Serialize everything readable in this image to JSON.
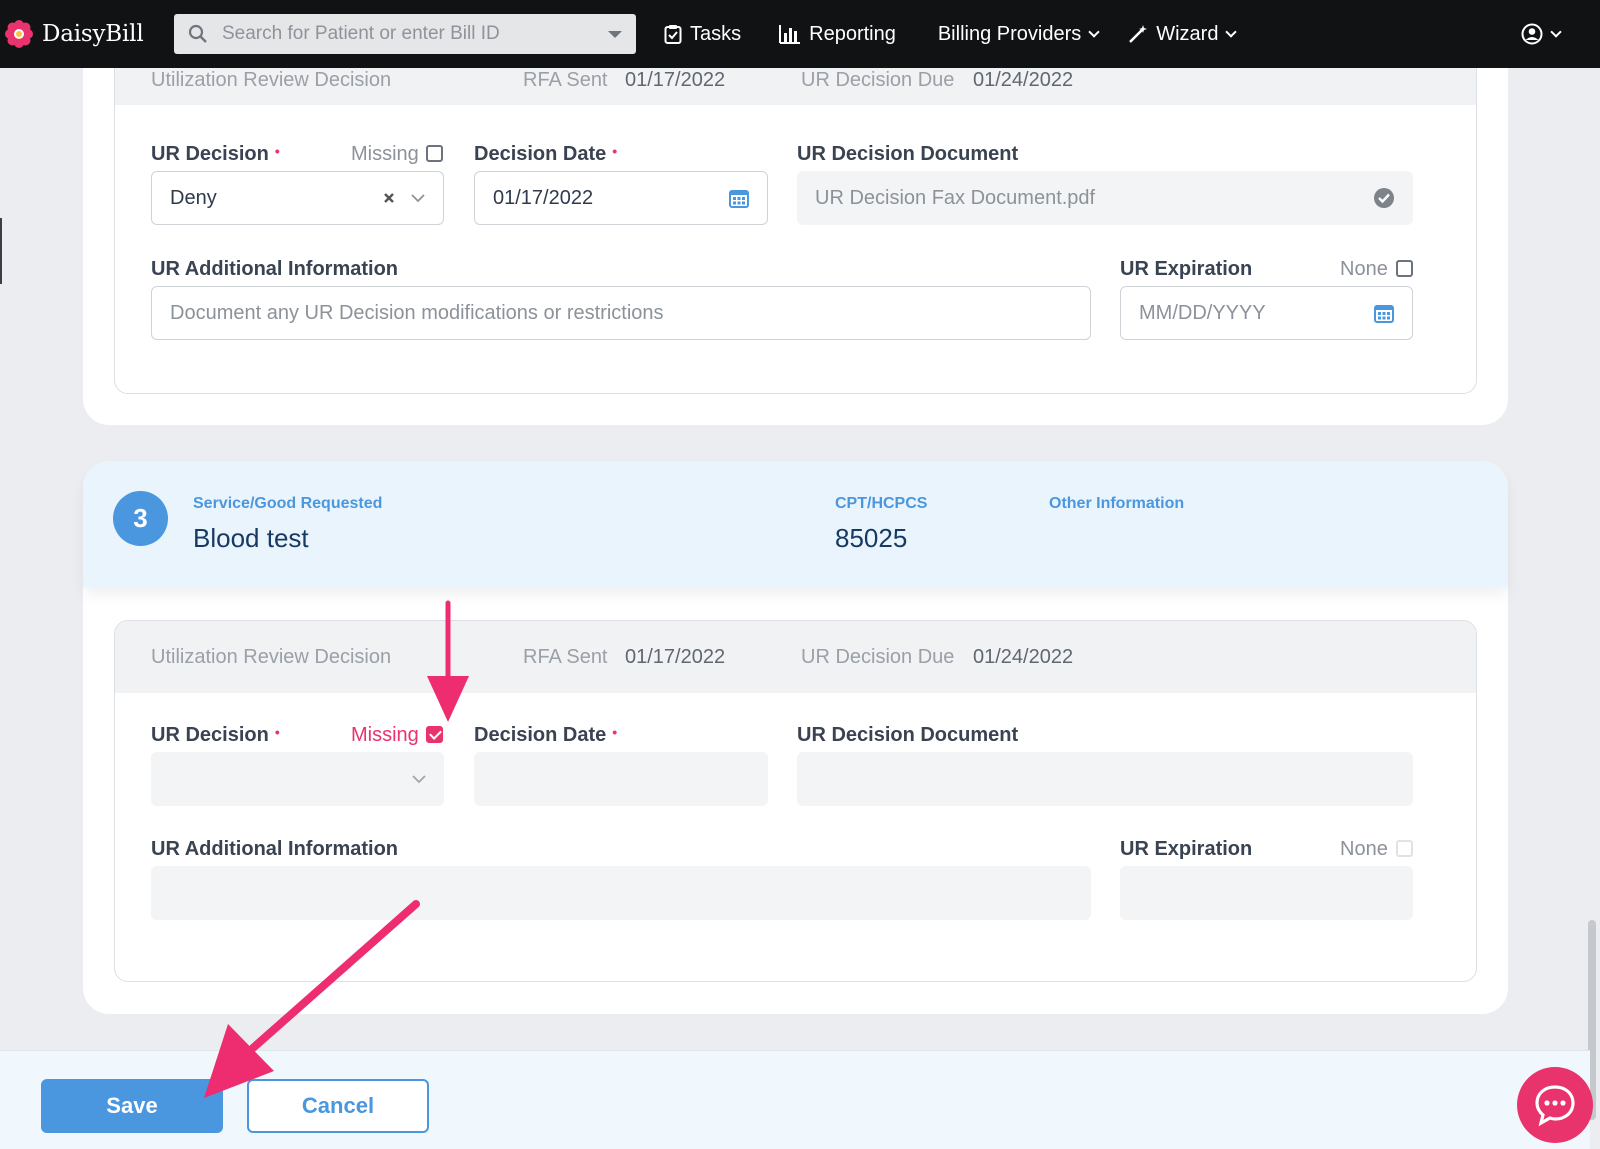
{
  "nav": {
    "brand": "DaisyBill",
    "search_placeholder": "Search for Patient or enter Bill ID",
    "tasks": "Tasks",
    "reporting": "Reporting",
    "billing_providers": "Billing Providers",
    "wizard": "Wizard"
  },
  "section_top": {
    "header_partial": {
      "title": "Utilization Review Decision",
      "rfa_sent_label": "RFA Sent",
      "rfa_sent_value": "01/17/2022",
      "due_label": "UR Decision Due",
      "due_value": "01/24/2022"
    },
    "ur_decision_label": "UR Decision",
    "missing_label": "Missing",
    "ur_decision_value": "Deny",
    "decision_date_label": "Decision Date",
    "decision_date_value": "01/17/2022",
    "document_label": "UR Decision Document",
    "document_value": "UR Decision Fax Document.pdf",
    "additional_label": "UR Additional Information",
    "additional_placeholder": "Document any UR Decision modifications or restrictions",
    "expiration_label": "UR Expiration",
    "none_label": "None",
    "expiration_placeholder": "MM/DD/YYYY"
  },
  "service": {
    "number": "3",
    "requested_label": "Service/Good Requested",
    "requested_value": "Blood test",
    "cpt_label": "CPT/HCPCS",
    "cpt_value": "85025",
    "other_label": "Other Information"
  },
  "section_bottom": {
    "header": {
      "title": "Utilization Review Decision",
      "rfa_sent_label": "RFA Sent",
      "rfa_sent_value": "01/17/2022",
      "due_label": "UR Decision Due",
      "due_value": "01/24/2022"
    },
    "ur_decision_label": "UR Decision",
    "missing_label": "Missing",
    "missing_checked": true,
    "decision_date_label": "Decision Date",
    "document_label": "UR Decision Document",
    "additional_label": "UR Additional Information",
    "expiration_label": "UR Expiration",
    "none_label": "None"
  },
  "footer": {
    "save": "Save",
    "cancel": "Cancel"
  },
  "colors": {
    "accent": "#4a97e0",
    "alert": "#e8336d",
    "nav_bg": "#111214"
  }
}
